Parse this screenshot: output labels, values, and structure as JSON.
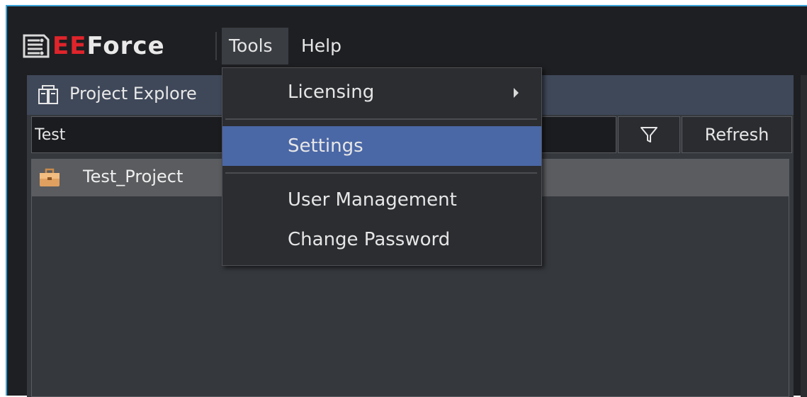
{
  "app": {
    "logo_icon": "eeforce-circuit-logo-icon",
    "logo_part_red": "EE",
    "logo_part_white": "Force",
    "brand_red": "#e0242b",
    "accent_border": "#3aa3d6"
  },
  "menubar": {
    "items": [
      {
        "label": "Tools",
        "open": true
      },
      {
        "label": "Help"
      }
    ]
  },
  "tools_menu": {
    "items": [
      {
        "label": "Licensing",
        "has_submenu": true,
        "icon": "chevron-right-icon"
      },
      {
        "label": "Settings",
        "selected": true
      },
      {
        "label": "User Management"
      },
      {
        "label": "Change Password"
      }
    ],
    "selected_color": "#4a67a6"
  },
  "project_explorer": {
    "title": "Project Explore",
    "icon": "project-explorer-icon",
    "search": {
      "value": "Test"
    },
    "filter_icon": "filter-icon",
    "refresh_label": "Refresh",
    "tree": [
      {
        "label": "Test_Project",
        "icon": "briefcase-icon"
      }
    ]
  }
}
